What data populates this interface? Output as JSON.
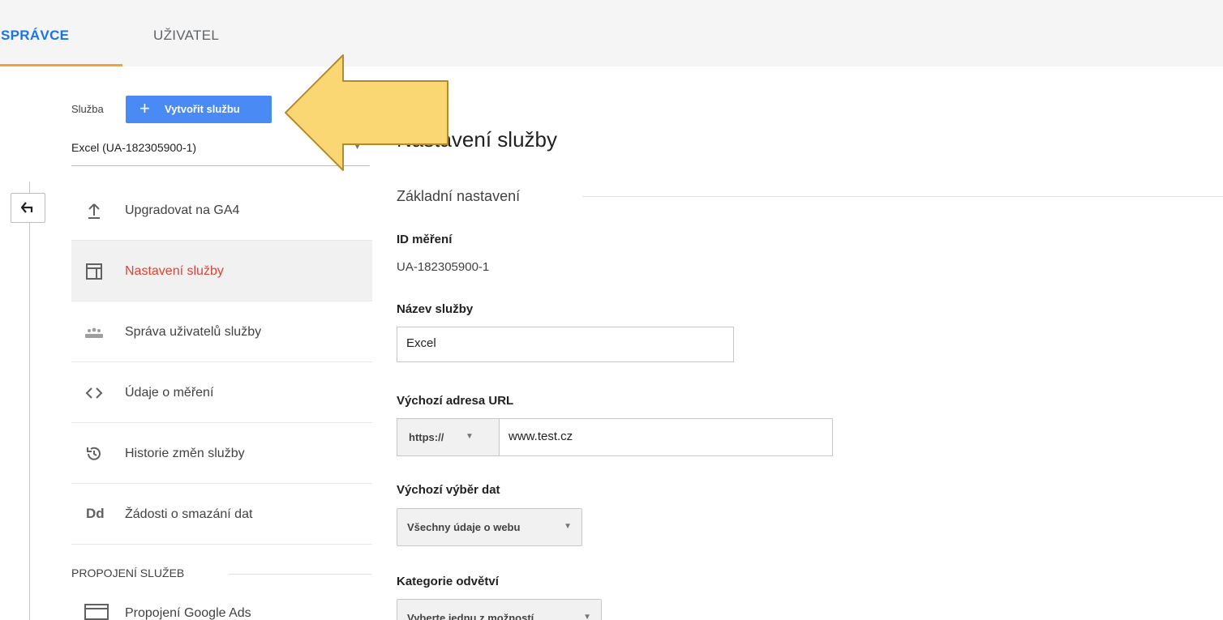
{
  "tabs": {
    "admin": "SPRÁVCE",
    "user": "UŽIVATEL"
  },
  "property": {
    "label": "Služba",
    "create_button": "Vytvořit službu",
    "selected": "Excel (UA-182305900-1)"
  },
  "nav": {
    "items": [
      {
        "label": "Upgradovat na GA4",
        "icon": "upload-icon"
      },
      {
        "label": "Nastavení služby",
        "icon": "property-settings-icon",
        "active": true
      },
      {
        "label": "Správa uživatelů služby",
        "icon": "people-icon"
      },
      {
        "label": "Údaje o měření",
        "icon": "code-icon"
      },
      {
        "label": "Historie změn služby",
        "icon": "history-icon"
      },
      {
        "label": "Žádosti o smazání dat",
        "icon": "dd-icon",
        "icon_text": "Dd"
      }
    ],
    "section": "PROPOJENÍ SLUŽEB",
    "partial_item": "Propojení Google Ads"
  },
  "main": {
    "title": "Nastavení služby",
    "subheading": "Základní nastavení",
    "tracking_id_label": "ID měření",
    "tracking_id": "UA-182305900-1",
    "name_label": "Název služby",
    "name_value": "Excel",
    "url_label": "Výchozí adresa URL",
    "url_scheme": "https://",
    "url_value": "www.test.cz",
    "view_label": "Výchozí výběr dat",
    "view_value": "Všechny údaje o webu",
    "industry_label": "Kategorie odvětví",
    "industry_value": "Vyberte jednu z možností"
  },
  "colors": {
    "accent_blue": "#4a8af4",
    "tab_underline": "#f4a236",
    "active_nav_text": "#db4437",
    "annotation_arrow": "#fbd774"
  }
}
